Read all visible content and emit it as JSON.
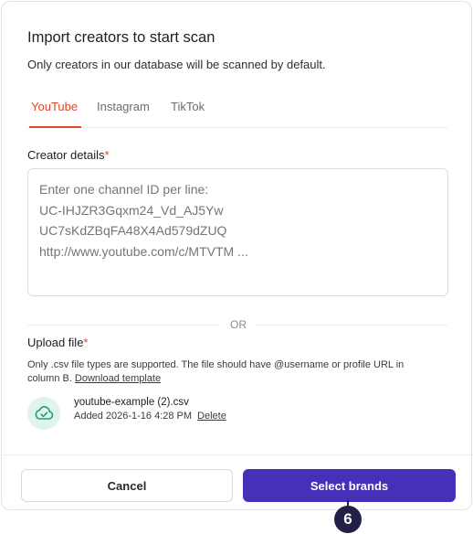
{
  "modal": {
    "title": "Import creators to start scan",
    "subtitle": "Only creators in our database will be scanned by default."
  },
  "tabs": [
    {
      "label": "YouTube",
      "active": true
    },
    {
      "label": "Instagram",
      "active": false
    },
    {
      "label": "TikTok",
      "active": false
    }
  ],
  "creator_details": {
    "label": "Creator details",
    "required_mark": "*",
    "placeholder": "Enter one channel ID per line:\nUC-IHJZR3Gqxm24_Vd_AJ5Yw\nUC7sKdZBqFA48X4Ad579dZUQ\nhttp://www.youtube.com/c/MTVTM ..."
  },
  "divider": {
    "text": "OR"
  },
  "upload": {
    "label": "Upload file",
    "required_mark": "*",
    "helper_text": "Only .csv file types are supported. The file should have @username or profile URL in column B.",
    "download_link": "Download template",
    "file": {
      "name": "youtube-example (2).csv",
      "added": "Added 2026-1-16 4:28 PM",
      "delete_label": "Delete",
      "icon": "cloud-check-icon"
    }
  },
  "footer": {
    "cancel_label": "Cancel",
    "select_label": "Select brands"
  },
  "step_badge": "6",
  "colors": {
    "accent_tab": "#e0462a",
    "primary_button": "#4630b8",
    "file_icon_bg": "#dff5ec",
    "file_icon_fg": "#1f9d6f",
    "badge": "#232048"
  }
}
